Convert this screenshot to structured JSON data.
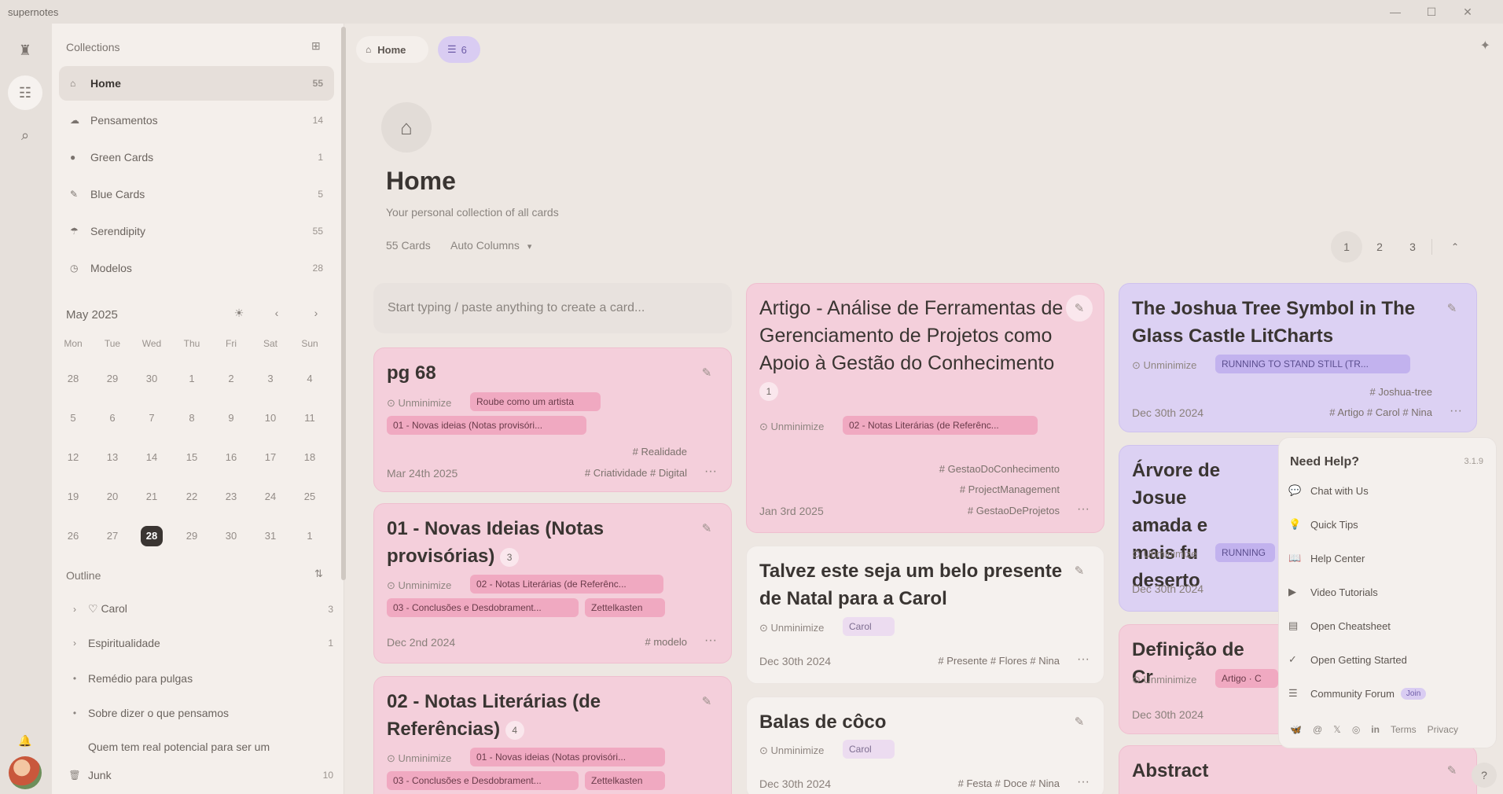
{
  "app": {
    "title": "supernotes"
  },
  "window": {
    "minimize": "—",
    "maximize": "☐",
    "close": "✕"
  },
  "rail": {
    "logo": "♜",
    "cards": "☷",
    "search": "⌕",
    "bell": "🔔"
  },
  "sidebar": {
    "collections_title": "Collections",
    "collections": [
      {
        "icon": "home-icon",
        "glyph": "⌂",
        "label": "Home",
        "count": "55"
      },
      {
        "icon": "thought-icon",
        "glyph": "☁",
        "label": "Pensamentos",
        "count": "14"
      },
      {
        "icon": "drop-icon",
        "glyph": "●",
        "label": "Green Cards",
        "count": "1"
      },
      {
        "icon": "tool-icon",
        "glyph": "✎",
        "label": "Blue Cards",
        "count": "5"
      },
      {
        "icon": "umbrella-icon",
        "glyph": "☂",
        "label": "Serendipity",
        "count": "55"
      },
      {
        "icon": "clock-icon",
        "glyph": "◷",
        "label": "Modelos",
        "count": "28"
      }
    ],
    "calendar": {
      "title": "May 2025",
      "dow": [
        "Mon",
        "Tue",
        "Wed",
        "Thu",
        "Fri",
        "Sat",
        "Sun"
      ],
      "days": [
        [
          "28",
          "29",
          "30",
          "1",
          "2",
          "3",
          "4"
        ],
        [
          "5",
          "6",
          "7",
          "8",
          "9",
          "10",
          "11"
        ],
        [
          "12",
          "13",
          "14",
          "15",
          "16",
          "17",
          "18"
        ],
        [
          "19",
          "20",
          "21",
          "22",
          "23",
          "24",
          "25"
        ],
        [
          "26",
          "27",
          "28",
          "29",
          "30",
          "31",
          "1"
        ]
      ],
      "today": "28"
    },
    "outline_title": "Outline",
    "outline": [
      {
        "arrow": "›",
        "label": "♡  Carol",
        "count": "3"
      },
      {
        "arrow": "›",
        "label": "Espiritualidade",
        "count": "1"
      },
      {
        "arrow": "•",
        "label": "Remédio para pulgas",
        "count": ""
      },
      {
        "arrow": "•",
        "label": "Sobre dizer o que pensamos",
        "count": ""
      },
      {
        "arrow": "",
        "label": "Quem tem real potencial para ser um",
        "count": ""
      }
    ],
    "junk": {
      "label": "Junk",
      "count": "10"
    }
  },
  "main": {
    "crumb_home": "Home",
    "crumb_filter": "6",
    "page_title": "Home",
    "page_subtitle": "Your personal collection of all cards",
    "count_label": "55 Cards",
    "columns_label": "Auto Columns",
    "pages": [
      "1",
      "2",
      "3"
    ],
    "composer_placeholder": "Start typing / paste anything to create a card...",
    "unminimize": "Unminimize"
  },
  "cards": {
    "c1": {
      "title": "pg 68",
      "chip1": "Roube como um artista",
      "chip2": "01 - Novas ideias (Notas provisóri...",
      "tags1": "# Realidade",
      "tags2": "# Criatividade   # Digital",
      "date": "Mar 24th 2025"
    },
    "c2": {
      "title": "01 - Novas Ideias (Notas provisórias)",
      "badge": "3",
      "chip1": "02 - Notas Literárias (de Referênc...",
      "chip2": "03 - Conclusões e Desdobrament...",
      "chip3": "Zettelkasten",
      "tags1": "# modelo",
      "date": "Dec 2nd 2024"
    },
    "c3": {
      "title": "02 - Notas Literárias (de Referências)",
      "badge": "4",
      "chip1": "01 - Novas ideias (Notas provisóri...",
      "chip2": "03 - Conclusões e Desdobrament...",
      "chip3": "Zettelkasten"
    },
    "c4": {
      "title": "Artigo - Análise de Ferramentas de Gerenciamento de Projetos como Apoio à Gestão do Conhecimento",
      "badge": "1",
      "chip1": "02 - Notas Literárias (de Referênc...",
      "tags1": "# GestaoDoConhecimento",
      "tags2": "# ProjectManagement",
      "tags3": "# GestaoDeProjetos",
      "date": "Jan 3rd 2025"
    },
    "c5": {
      "title": "Talvez este seja um belo presente de Natal para a Carol",
      "chip1": "Carol",
      "tags1": "# Presente   # Flores   # Nina",
      "date": "Dec 30th 2024"
    },
    "c6": {
      "title": "Balas de côco",
      "chip1": "Carol",
      "tags1": "# Festa   # Doce   # Nina",
      "date": "Dec 30th 2024"
    },
    "c7": {
      "title": "The Joshua Tree Symbol in The Glass Castle LitCharts",
      "chip1": "RUNNING TO STAND STILL (TR...",
      "tags1": "# Joshua-tree",
      "tags2": "# Artigo   # Carol   # Nina",
      "date": "Dec 30th 2024"
    },
    "c8": {
      "title": "Árvore de Josue amada e mais fu deserto",
      "chip1": "RUNNING",
      "date": "Dec 30th 2024"
    },
    "c9": {
      "title": "Definição de Cr",
      "chip1": "Artigo · C",
      "date": "Dec 30th 2024"
    },
    "c10": {
      "title": "Abstract"
    }
  },
  "help": {
    "title": "Need Help?",
    "version": "3.1.9",
    "items": [
      {
        "icon": "chat-icon",
        "glyph": "💬",
        "label": "Chat with Us"
      },
      {
        "icon": "bulb-icon",
        "glyph": "💡",
        "label": "Quick Tips"
      },
      {
        "icon": "book-icon",
        "glyph": "📖",
        "label": "Help Center"
      },
      {
        "icon": "video-icon",
        "glyph": "▶",
        "label": "Video Tutorials"
      },
      {
        "icon": "sheet-icon",
        "glyph": "▤",
        "label": "Open Cheatsheet"
      },
      {
        "icon": "start-icon",
        "glyph": "✓",
        "label": "Open Getting Started"
      },
      {
        "icon": "forum-icon",
        "glyph": "☰",
        "label": "Community Forum"
      }
    ],
    "join": "Join",
    "terms": "Terms",
    "privacy": "Privacy"
  }
}
